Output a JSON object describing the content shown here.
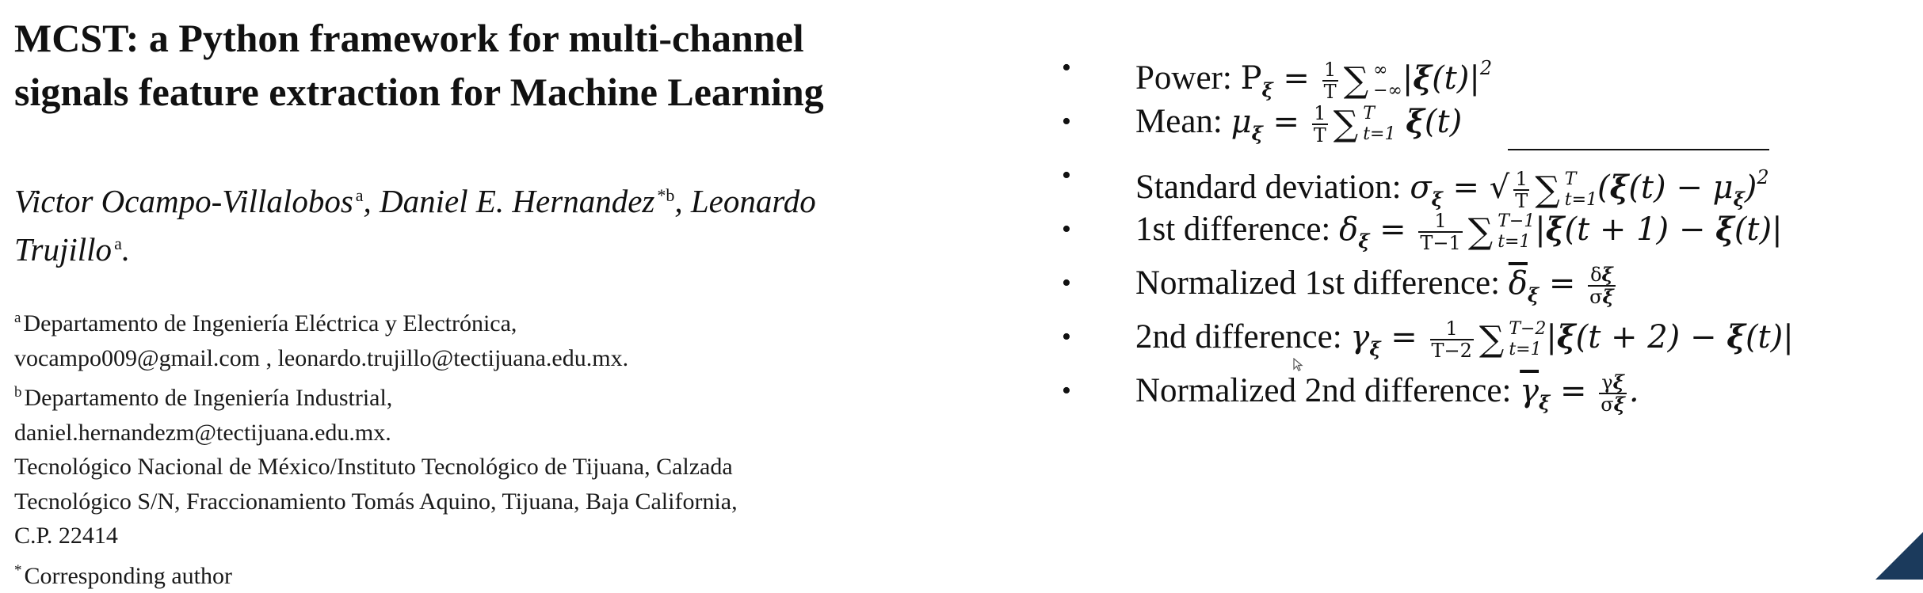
{
  "paper": {
    "title_lines": [
      "MCST: a Python framework for multi-channel",
      "signals feature extraction for Machine Learning"
    ],
    "authors": {
      "line1_a": "Victor Ocampo-Villalobos",
      "line1_a_sup": "a",
      "line1_b": ", Daniel E. Hernandez",
      "line1_b_sup": "*b",
      "line1_c": ", Leonardo",
      "line2": "Trujillo",
      "line2_sup": "a",
      "line2_end": "."
    },
    "affiliations": {
      "a_sup": "a",
      "a_dept": "Departamento de Ingeniería Eléctrica y Electrónica,",
      "a_emails": "vocampo009@gmail.com , leonardo.trujillo@tectijuana.edu.mx.",
      "b_sup": "b",
      "b_dept": "Departamento de Ingeniería Industrial,",
      "b_email": "daniel.hernandezm@tectijuana.edu.mx.",
      "institute_1": "Tecnológico Nacional de México/Instituto Tecnológico de Tijuana, Calzada",
      "institute_2": "Tecnológico S/N, Fraccionamiento Tomás Aquino, Tijuana, Baja California,",
      "institute_3": "C.P. 22414",
      "corr_sup": "*",
      "corr_note": "Corresponding author"
    }
  },
  "features": {
    "bullet_glyph": "•",
    "power_label": "Power: ",
    "mean_label": "Mean: ",
    "std_label": "Standard deviation: ",
    "diff1_label": "1st difference: ",
    "ndiff1_label": "Normalized 1st difference: ",
    "diff2_label": "2nd difference: ",
    "ndiff2_label": "Normalized 2nd difference: "
  },
  "decoration_color": "#1b3a5c"
}
